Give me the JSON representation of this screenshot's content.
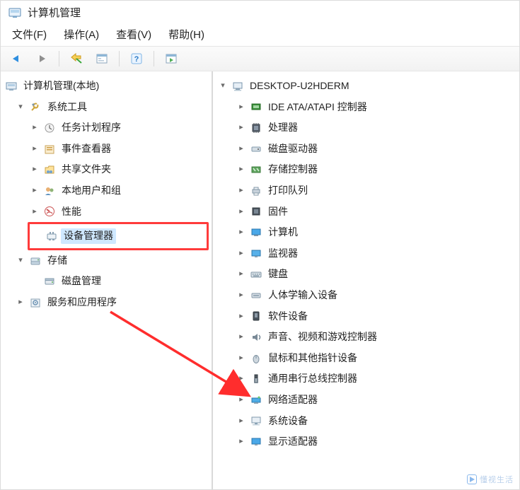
{
  "window_title": "计算机管理",
  "menu": {
    "file": "文件(F)",
    "action": "操作(A)",
    "view": "查看(V)",
    "help": "帮助(H)"
  },
  "left_tree": {
    "root": "计算机管理(本地)",
    "system_tools": {
      "label": "系统工具",
      "children": {
        "task_scheduler": "任务计划程序",
        "event_viewer": "事件查看器",
        "shared_folders": "共享文件夹",
        "local_users": "本地用户和组",
        "performance": "性能",
        "device_manager": "设备管理器"
      }
    },
    "storage": {
      "label": "存储",
      "children": {
        "disk_mgmt": "磁盘管理"
      }
    },
    "services": "服务和应用程序"
  },
  "right_tree": {
    "root": "DESKTOP-U2HDERM",
    "items": {
      "ide": "IDE ATA/ATAPI 控制器",
      "cpu": "处理器",
      "disk_drives": "磁盘驱动器",
      "storage_ctrl": "存储控制器",
      "print_queue": "打印队列",
      "firmware": "固件",
      "computer": "计算机",
      "monitor": "监视器",
      "keyboard": "键盘",
      "hid": "人体学输入设备",
      "software_dev": "软件设备",
      "sound": "声音、视频和游戏控制器",
      "mouse": "鼠标和其他指针设备",
      "usb": "通用串行总线控制器",
      "network": "网络适配器",
      "system_dev": "系统设备",
      "display": "显示适配器"
    }
  },
  "watermark": "懂视生活"
}
